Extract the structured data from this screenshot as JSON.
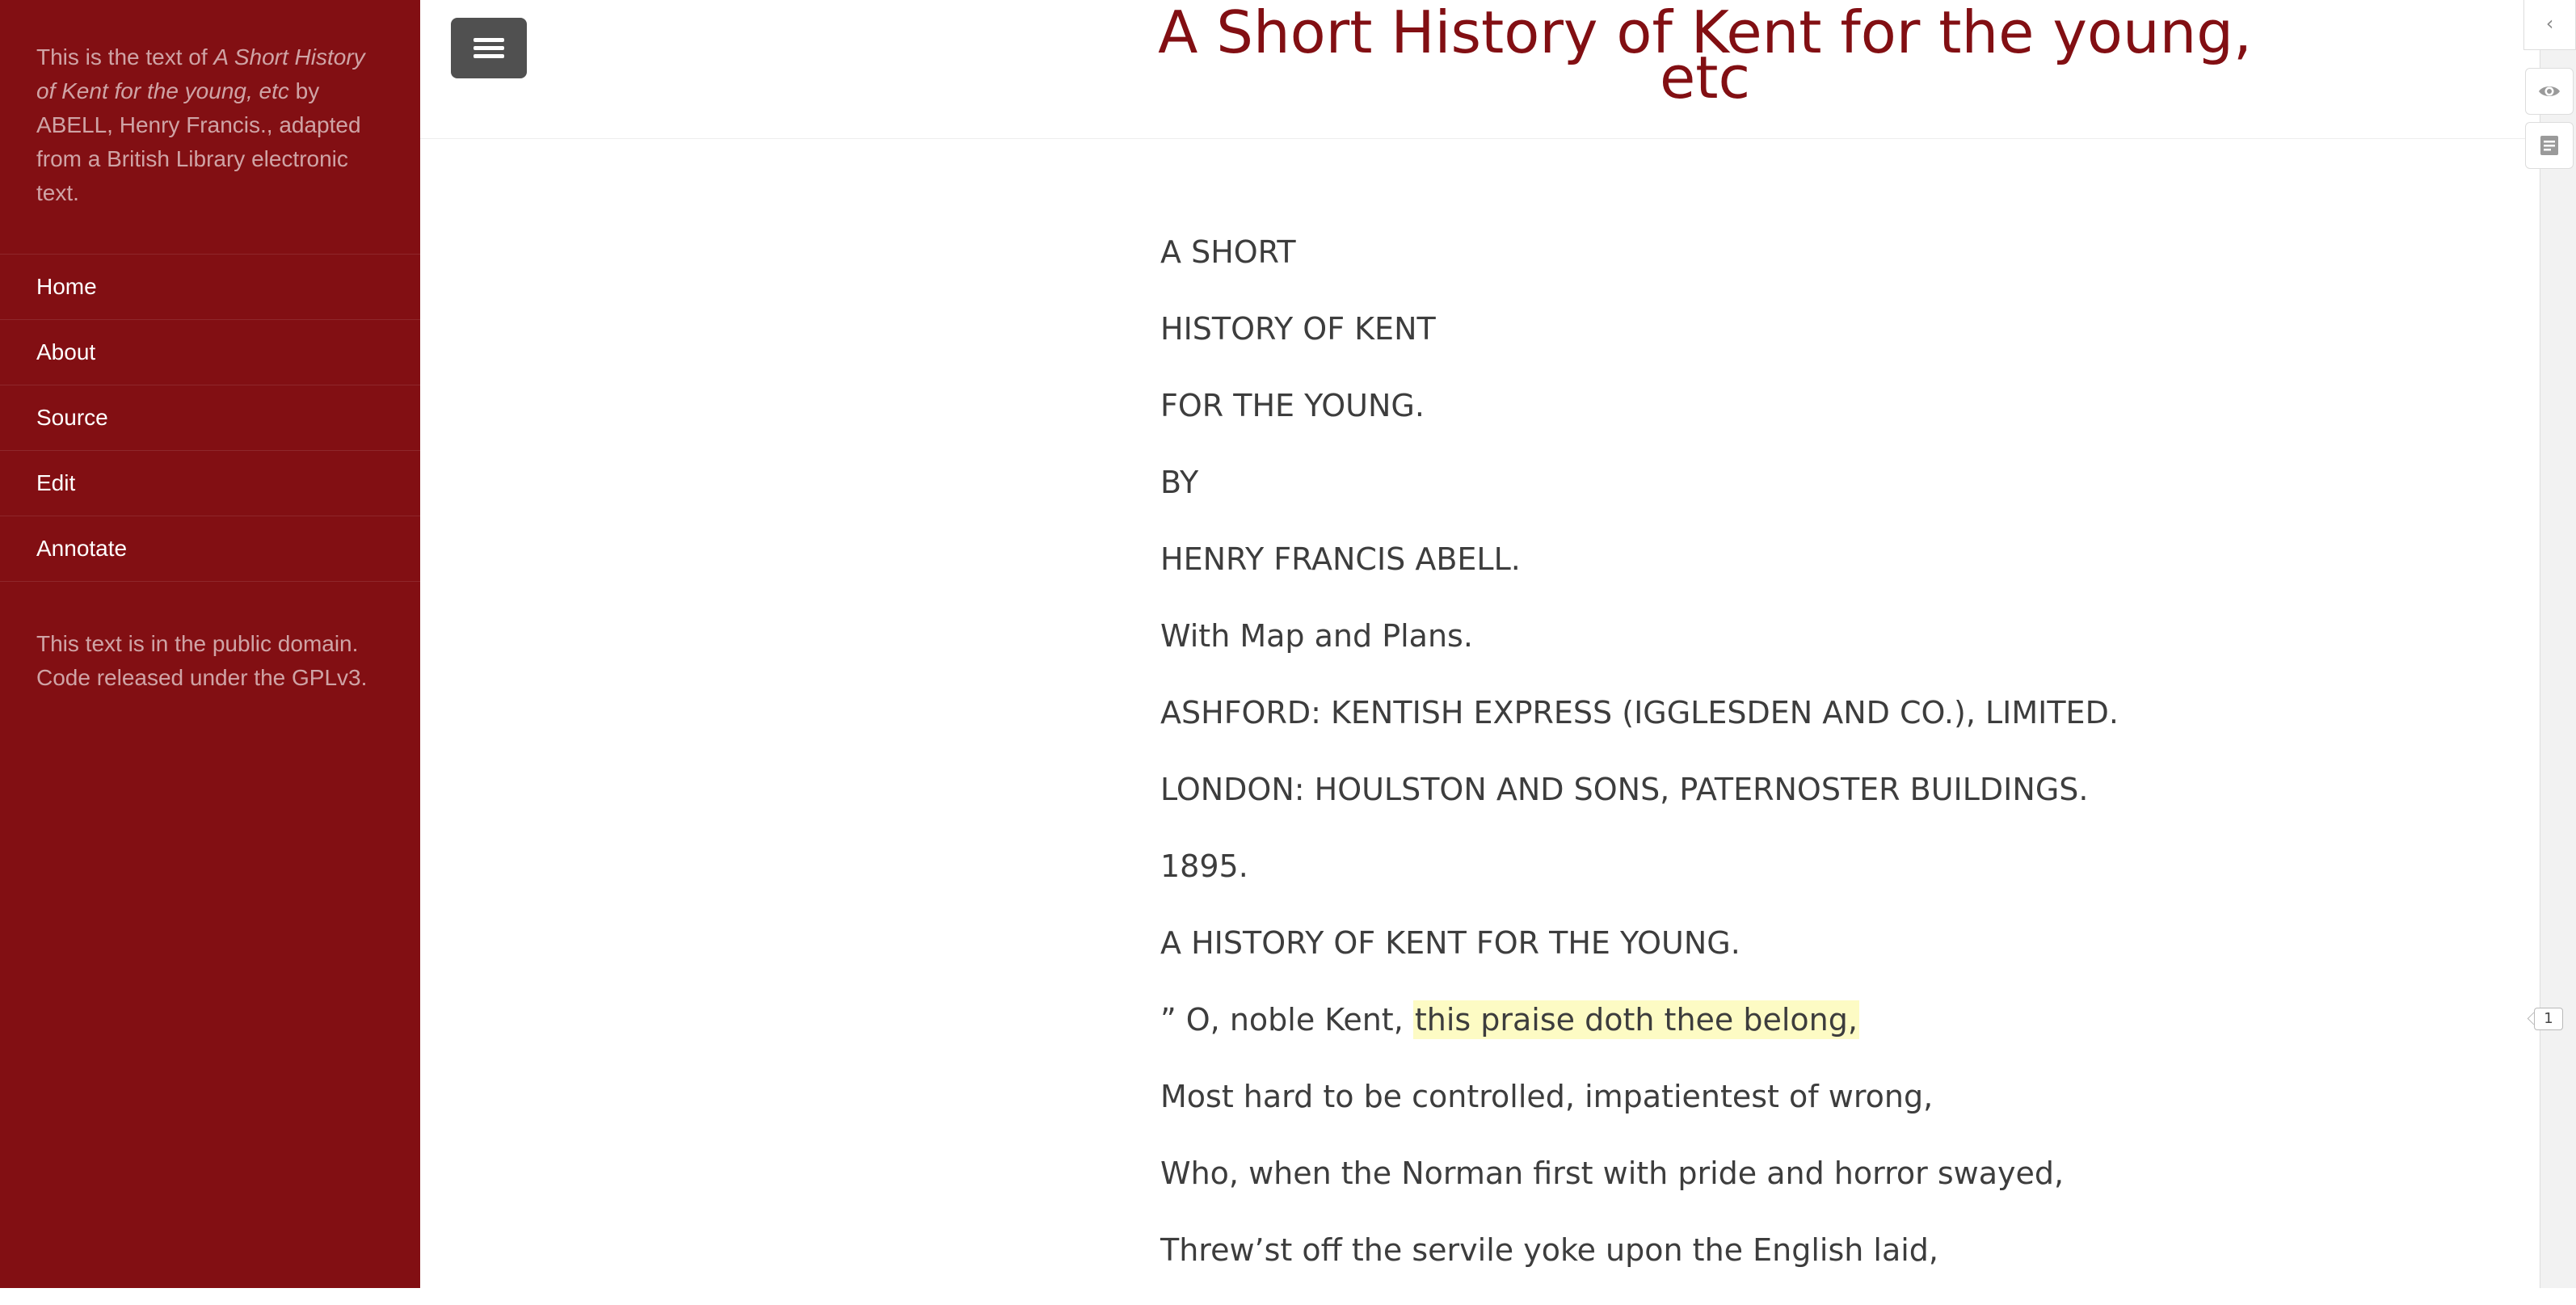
{
  "sidebar": {
    "about": {
      "prefix": "This is the text of ",
      "book_title": "A Short History of Kent for the young, etc",
      "suffix": " by ABELL, Henry Francis., adapted from a British Library electronic text."
    },
    "nav": [
      {
        "label": "Home"
      },
      {
        "label": "About"
      },
      {
        "label": "Source"
      },
      {
        "label": "Edit"
      },
      {
        "label": "Annotate"
      }
    ],
    "footer": {
      "line1": "This text is in the public domain.",
      "line2": "Code released under the GPLv3."
    }
  },
  "header": {
    "title_line1": "A Short History of Kent for the young,",
    "title_line2": "etc",
    "menu_icon": "hamburger-menu-icon"
  },
  "content": {
    "lines": [
      "A SHORT",
      "HISTORY OF KENT",
      "FOR THE YOUNG.",
      "BY",
      "HENRY FRANCIS ABELL.",
      "With Map and Plans.",
      "ASHFORD: KENTISH EXPRESS (IGGLESDEN AND CO.), LIMITED.",
      "LONDON: HOULSTON AND SONS, PATERNOSTER BUILDINGS.",
      "1895.",
      "A HISTORY OF KENT FOR THE YOUNG."
    ],
    "verse_prefix": "” O, noble Kent, ",
    "verse_highlight": "this praise doth thee belong,",
    "verse_lines": [
      "Most hard to be controlled, impatientest of wrong,",
      "Who, when the Norman first with pride and horror swayed,",
      "Threw’st off the servile yoke upon the English laid,"
    ]
  },
  "annotator": {
    "toggle_icon": "chevron-left-icon",
    "visibility_icon": "eye-icon",
    "notes_icon": "notes-icon",
    "highlight_count": "1",
    "highlight_color": "#fdfbc4"
  },
  "colors": {
    "brand": "#820f13",
    "text": "#3d3d3d"
  }
}
